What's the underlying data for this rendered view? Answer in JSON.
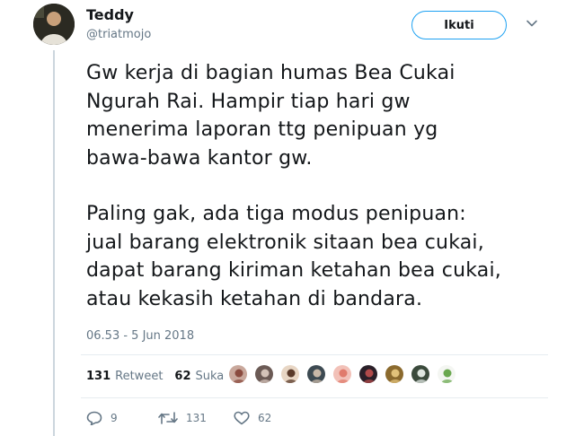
{
  "user": {
    "name": "Teddy",
    "handle": "@triatmojo"
  },
  "follow_label": "Ikuti",
  "tweet": {
    "paragraph1": "Gw kerja di bagian humas Bea Cukai\nNgurah Rai. Hampir tiap hari gw\nmenerima laporan ttg penipuan yg\nbawa-bawa kantor gw.",
    "paragraph2": "Paling gak, ada tiga modus penipuan:\njual barang elektronik sitaan bea cukai,\ndapat barang kiriman ketahan bea cukai,\natau kekasih ketahan di bandara.",
    "timestamp": "06.53 - 5 Jun 2018"
  },
  "stats": {
    "retweet_count": "131",
    "retweet_label": "Retweet",
    "like_count": "62",
    "like_label": "Suka"
  },
  "likers": [
    {
      "color": "#c9a89c",
      "accent": "#8a4b3f"
    },
    {
      "color": "#6b5a55",
      "accent": "#d3c2b8"
    },
    {
      "color": "#e8d6c4",
      "accent": "#5a3a2a"
    },
    {
      "color": "#3d4a52",
      "accent": "#c8b8a8"
    },
    {
      "color": "#f2c1b8",
      "accent": "#e07b6c"
    },
    {
      "color": "#2a1f28",
      "accent": "#b04a4a"
    },
    {
      "color": "#8b6a2e",
      "accent": "#e2c27a"
    },
    {
      "color": "#3b4a3c",
      "accent": "#dfe6e0"
    },
    {
      "color": "#f4f6f2",
      "accent": "#6aa84f"
    }
  ],
  "actions": {
    "reply_count": "9",
    "retweet_count": "131",
    "like_count": "62"
  },
  "colors": {
    "accent": "#1da1f2",
    "muted": "#657786",
    "divider": "#e6ecf0"
  }
}
